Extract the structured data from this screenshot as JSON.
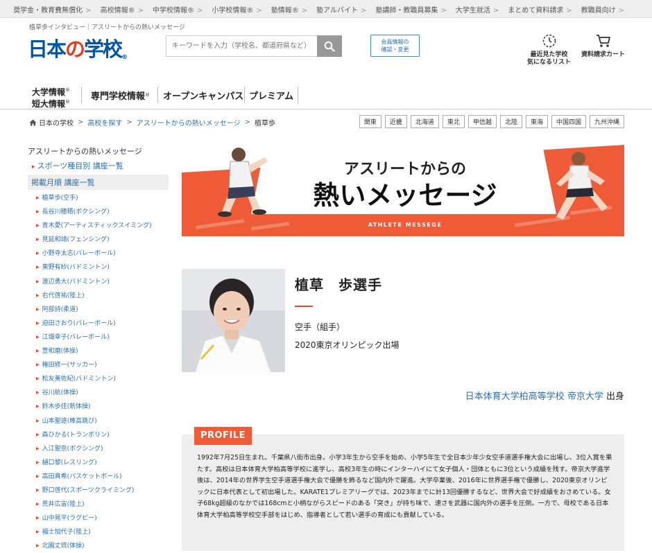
{
  "topnav": [
    "奨学金・教育費無償化",
    "高校情報®",
    "中学校情報®",
    "小学校情報®",
    "塾情報®",
    "塾アルバイト",
    "塾講師・教職員募集",
    "大学生就活",
    "まとめて資料請求",
    "教職員向け"
  ],
  "header": {
    "subtitle": "植草歩インタビュー｜アスリートからの熱いメッセージ",
    "logo_main": "日本",
    "logo_no": "の",
    "logo_end": "学校",
    "logo_reg": "®",
    "search_placeholder": "キーワードを入力（学校名、都道府県など）",
    "member_button_line1": "会員情報の",
    "member_button_line2": "確認・変更",
    "recent_line1": "最近見た学校",
    "recent_line2": "気になるリスト",
    "cart_label": "資料請求カート"
  },
  "catnav": {
    "univ_line1": "大学情報",
    "univ_line2": "短大情報",
    "reg": "®",
    "vocational": "専門学校情報",
    "opencampus": "オープンキャンパス",
    "premium": "プレミアム"
  },
  "breadcrumb": {
    "items": [
      "日本の学校",
      "高校を探す",
      "アスリートからの熱いメッセージ"
    ],
    "current": "植草歩",
    "separator": ">"
  },
  "regions": [
    "関東",
    "近畿",
    "北海道",
    "東北",
    "甲信越",
    "北陸",
    "東海",
    "中国四国",
    "九州沖縄"
  ],
  "sidebar": {
    "heading": "アスリートからの熱いメッセージ",
    "link_sports": "スポーツ種目別 講座一覧",
    "active_item": "掲載月順 講座一覧",
    "athletes": [
      "植草歩(空手)",
      "長谷川穂積(ボクシング)",
      "青木愛(アーティスティックスイミング)",
      "見延和靖(フェンシング)",
      "小野寺太志(バレーボール)",
      "東野有紗(バドミントン)",
      "渡辺勇大(バドミントン)",
      "右代啓祐(陸上)",
      "阿部詩(柔道)",
      "迫田さおり(バレーボール)",
      "江畑幸子(バレーボール)",
      "萱和磨(体操)",
      "権田修一(サッカー)",
      "松友美佐紀(バドミントン)",
      "谷川航(体操)",
      "鈴木歩佳(新体操)",
      "山本聖途(棒高跳び)",
      "森ひかる(トランポリン)",
      "入江聖奈(ボクシング)",
      "樋口黎(レスリング)",
      "高田真希(バスケットボール)",
      "野口啓代(スポーツクライミング)",
      "荒井広宙(陸上)",
      "山中晃平(ラグビー)",
      "福士加代子(陸上)",
      "北園丈琉(体操)"
    ]
  },
  "banner": {
    "line1": "アスリートからの",
    "line2": "熱いメッセージ",
    "sub": "ATHLETE MESSEGE",
    "accent_color": "#ef5a37"
  },
  "athlete": {
    "name": "植草　歩選手",
    "sport": "空手（組手）",
    "event": "2020東京オリンピック出場",
    "school1": "日本体育大学柏高等学校",
    "school2": "帝京大学",
    "origin_suffix": "出身"
  },
  "profile": {
    "tag": "PROFILE",
    "text": "1992年7月25日生まれ。千葉県八街市出身。小学3年生から空手を始め、小学5年生で全日本少年少女空手道選手権大会に出場し、3位入賞を果たす。高校は日本体育大学柏高等学校に進学し、高校3年生の時にインターハイにて女子個人・団体ともに3位という成績を残す。帝京大学進学後は、2014年の世界学生空手道選手権大会で優勝を飾るなど国内外で躍進。大学卒業後、2016年に世界選手権で優勝し、2020東京オリンピックに日本代表として初出場した。KARATE1プレミアリーグでは、2023年までに計13回優勝するなど、世界大会で好成績をおさめている。女子68kg超級のなかでは168cmと小柄ながらスピードのある「突き」が持ち味で、速さを武器に国内外の選手を圧倒。一方で、母校である日本体育大学柏高等学校空手部をはじめ、指導者として若い選手の育成にも貢献している。"
  }
}
